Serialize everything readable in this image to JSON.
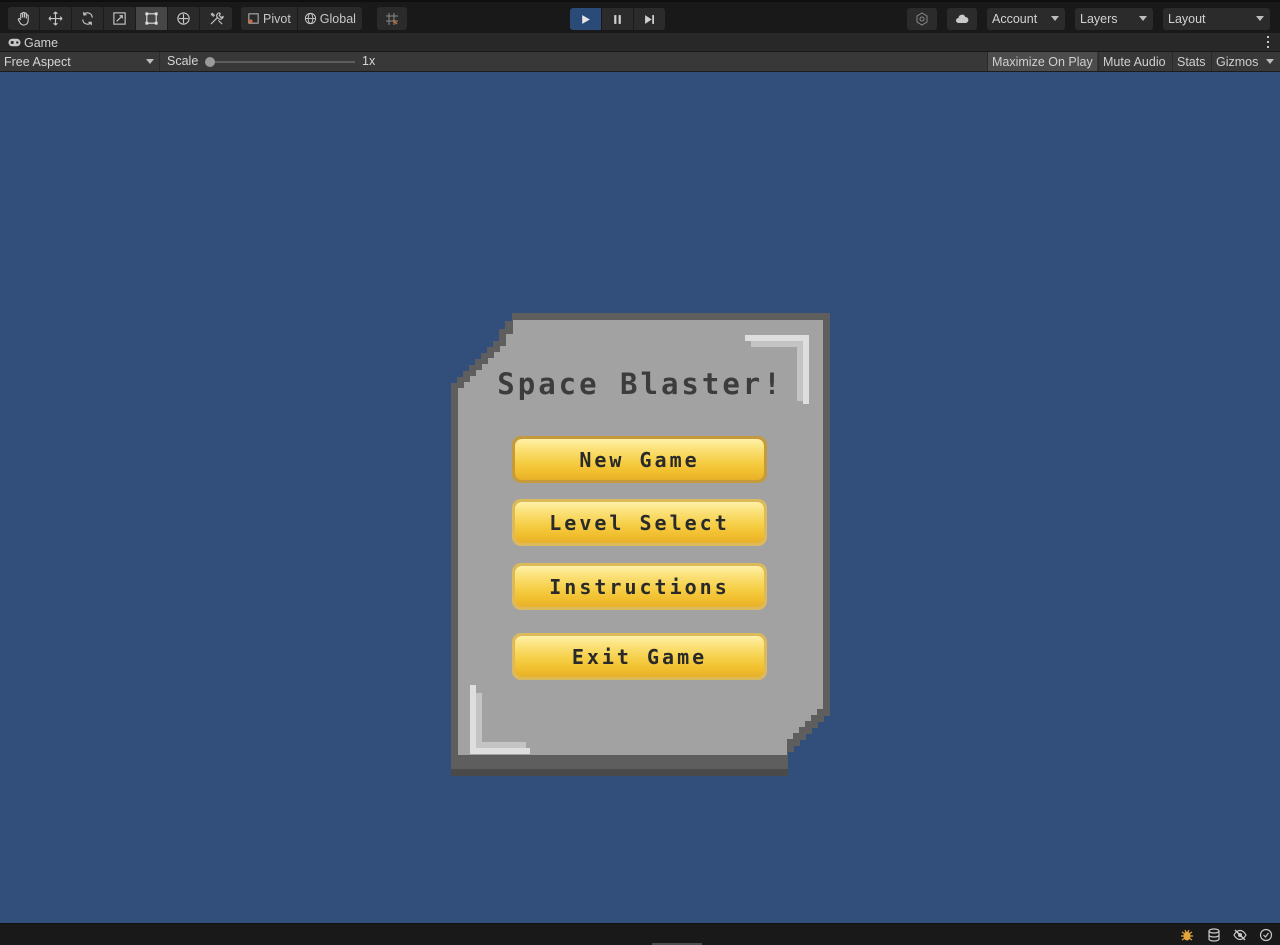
{
  "toolbar": {
    "tools": [
      {
        "icon": "hand-icon",
        "active": false
      },
      {
        "icon": "move-icon",
        "active": false
      },
      {
        "icon": "rotate-icon",
        "active": false
      },
      {
        "icon": "scale-icon",
        "active": false
      },
      {
        "icon": "rect-tool-icon",
        "active": true
      },
      {
        "icon": "transform-icon",
        "active": false
      },
      {
        "icon": "custom-tools-icon",
        "active": false
      }
    ],
    "pivot_label": "Pivot",
    "global_label": "Global",
    "account_label": "Account",
    "layers_label": "Layers",
    "layout_label": "Layout",
    "play_active_color": "#2a4b77"
  },
  "game_tab": {
    "title": "Game"
  },
  "game_controls": {
    "aspect": "Free Aspect",
    "scale_label": "Scale",
    "scale_value": "1x",
    "maximize_on_play": "Maximize On Play",
    "mute_audio": "Mute Audio",
    "stats": "Stats",
    "gizmos": "Gizmos"
  },
  "game_view": {
    "background_color": "#314f7a",
    "menu": {
      "title": "Space Blaster!",
      "buttons": [
        {
          "label": "New Game"
        },
        {
          "label": "Level Select"
        },
        {
          "label": "Instructions"
        },
        {
          "label": "Exit Game"
        }
      ]
    }
  },
  "statusbar": {
    "icons": [
      "bug-icon",
      "database-icon",
      "hidden-eye-icon",
      "check-circle-icon"
    ]
  }
}
